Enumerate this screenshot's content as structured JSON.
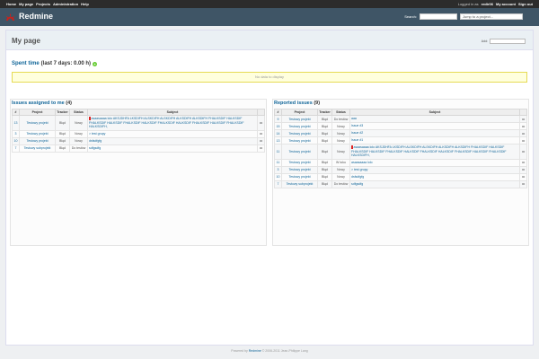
{
  "top_menu": {
    "items": [
      "Home",
      "My page",
      "Projects",
      "Administration",
      "Help"
    ],
    "logged_in_as": "Logged in as",
    "user": "redir06",
    "my_account": "My account",
    "sign_out": "Sign out"
  },
  "header": {
    "title": "Redmine",
    "search_label": "Search:",
    "search_value": "",
    "jump_label": "Jump to a project..."
  },
  "page": {
    "title": "My page",
    "add_label": "Add:",
    "add_value": ""
  },
  "spent": {
    "title": "Spent time",
    "detail": "(last 7 days: 0.00 h)",
    "nodata": "No data to display"
  },
  "assigned": {
    "title": "Issues assigned to me",
    "count": "(4)",
    "headers": [
      "#",
      "Project",
      "Tracker",
      "Status",
      "Subject",
      ""
    ],
    "rows": [
      {
        "id": "13",
        "project": "Testowy projekt",
        "tracker": "Błąd",
        "status": "Nowy",
        "subject": "asaasaaaa lolo AKSJDHFA LKSDIFH ALSKDIFH ALSKDIFH ALKSDIFH ALKSDIFH FHALKSDIF HALKSDIF FHALKSDIF HALKSDIF FHALKSDIF HALKSDIF FHALKSDIF HALKSDIF FHALKSDIF HALKSDIF FHALKSDIF HALKSDIFH,",
        "flag": true
      },
      {
        "id": "3",
        "project": "Testowy projekt",
        "tracker": "Błąd",
        "status": "Nowy",
        "subject": "> test grupy",
        "flag": false
      },
      {
        "id": "10",
        "project": "Testowy projekt",
        "tracker": "Błąd",
        "status": "Nowy",
        "subject": "dsfsdfgfg",
        "flag": false
      },
      {
        "id": "7",
        "project": "Testowy subprojekt",
        "tracker": "Błąd",
        "status": "Do testów",
        "subject": "sdfgsdfg",
        "flag": false
      }
    ]
  },
  "reported": {
    "title": "Reported issues",
    "count": "(9)",
    "headers": [
      "#",
      "Project",
      "Tracker",
      "Status",
      "Subject",
      ""
    ],
    "rows": [
      {
        "id": "9",
        "project": "Testowy projekt",
        "tracker": "Błąd",
        "status": "Do testów",
        "subject": "aaa",
        "flag": false
      },
      {
        "id": "15",
        "project": "Testowy projekt",
        "tracker": "Błąd",
        "status": "Nowy",
        "subject": "Issue #3",
        "flag": false
      },
      {
        "id": "14",
        "project": "Testowy projekt",
        "tracker": "Błąd",
        "status": "Nowy",
        "subject": "Issue #2",
        "flag": false
      },
      {
        "id": "13",
        "project": "Testowy projekt",
        "tracker": "Błąd",
        "status": "Nowy",
        "subject": "Issue #1",
        "flag": false
      },
      {
        "id": "11",
        "project": "Testowy projekt",
        "tracker": "Błąd",
        "status": "Nowy",
        "subject": "asaasaaaa lolo AKSJDHFA LKSDIFH ALSKDIFH ALSKDIFH ALKSDIFH ALKSDIFH FHALKSDIF HALKSDIF FHALKSDIF HALKSDIF FHALKSDIF HALKSDIF FHALKSDIF HALKSDIF FHALKSDIF HALKSDIF FHALKSDIF HALKSDIFH,",
        "flag": true
      },
      {
        "id": "11",
        "project": "Testowy projekt",
        "tracker": "Błąd",
        "status": "W toku",
        "subject": "asaasaaaa lolo",
        "flag": false
      },
      {
        "id": "3",
        "project": "Testowy projekt",
        "tracker": "Błąd",
        "status": "Nowy",
        "subject": "> test grupy",
        "flag": false
      },
      {
        "id": "10",
        "project": "Testowy projekt",
        "tracker": "Błąd",
        "status": "Nowy",
        "subject": "dsfsdfgfg",
        "flag": false
      },
      {
        "id": "7",
        "project": "Testowy subprojekt",
        "tracker": "Błąd",
        "status": "Do testów",
        "subject": "sdfgsdfg",
        "flag": false
      }
    ]
  },
  "footer": {
    "prefix": "Powered by",
    "brand": "Redmine",
    "suffix": "© 2006-2011 Jean-Philippe Lang"
  }
}
